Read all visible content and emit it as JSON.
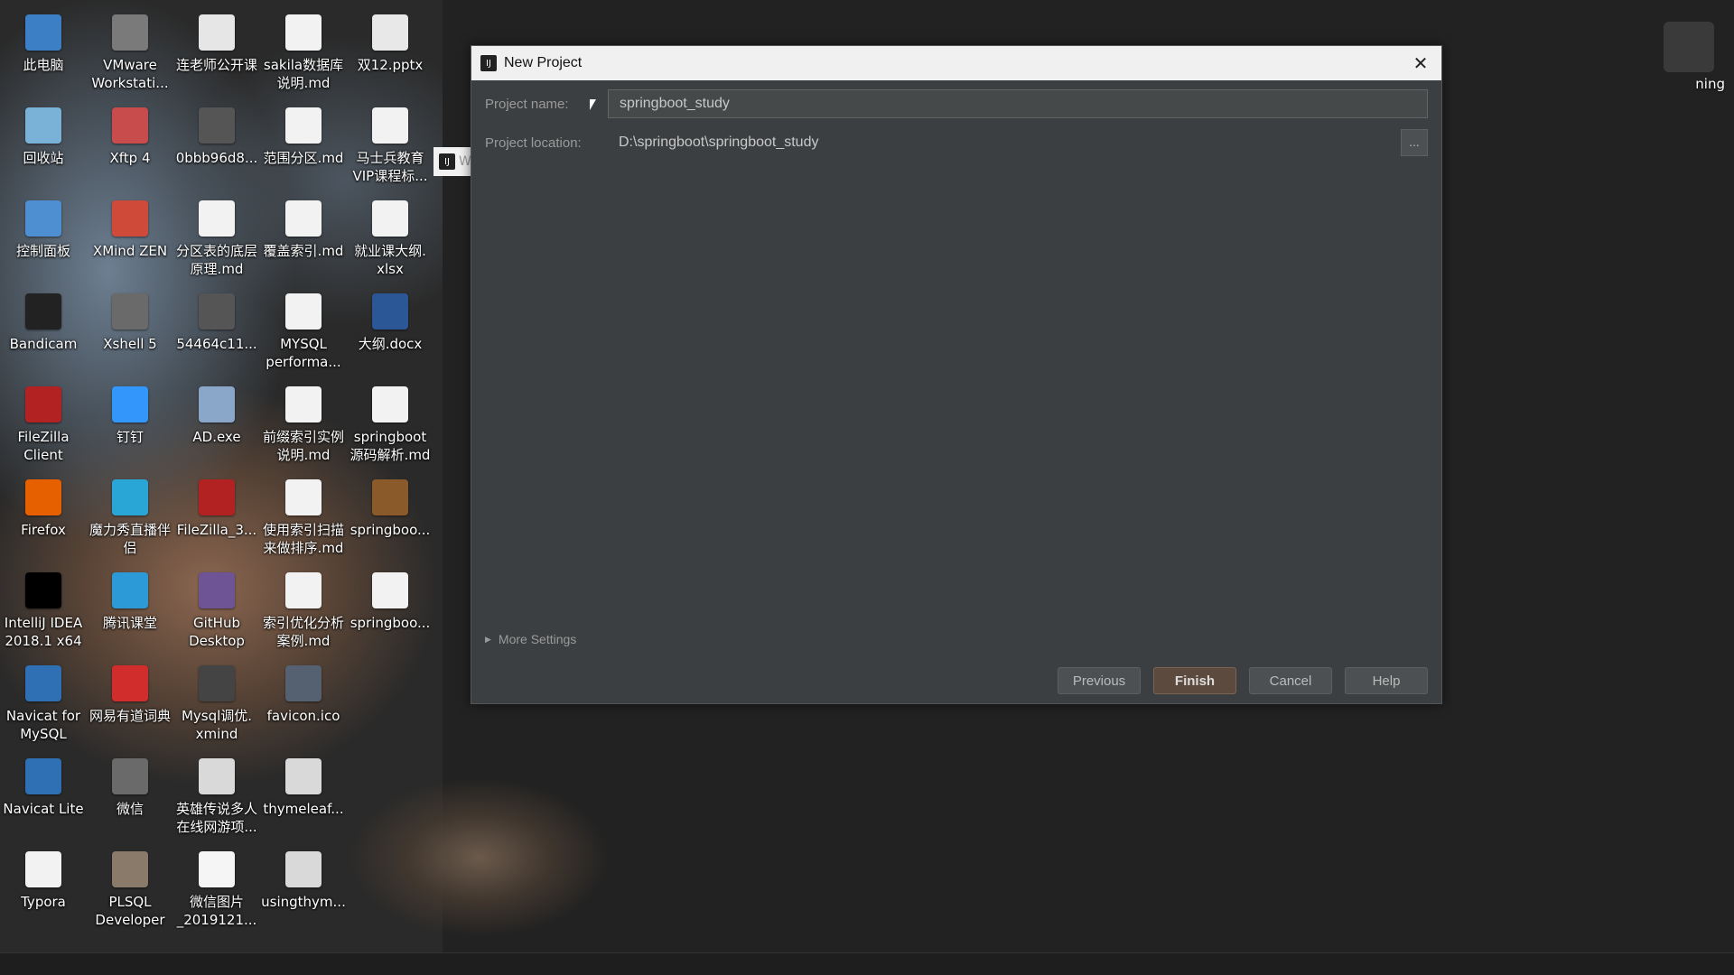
{
  "desktop": {
    "icons": [
      {
        "label": "此电脑",
        "icon": "computer-icon",
        "color": "#3c7fc4"
      },
      {
        "label": "VMware\nWorkstati...",
        "icon": "vmware-icon",
        "color": "#7a7a7a"
      },
      {
        "label": "连老师公开课",
        "icon": "file-icon",
        "color": "#e6e6e6"
      },
      {
        "label": "sakila数据库\n说明.md",
        "icon": "markdown-icon",
        "color": "#f2f2f2"
      },
      {
        "label": "双12.pptx",
        "icon": "pptx-icon",
        "color": "#e8e8e8"
      },
      {
        "label": "回收站",
        "icon": "recycle-bin-icon",
        "color": "#7ab1d6"
      },
      {
        "label": "Xftp 4",
        "icon": "xftp-icon",
        "color": "#c94c4c"
      },
      {
        "label": "0bbb96d8...",
        "icon": "image-icon",
        "color": "#555555"
      },
      {
        "label": "范围分区.md",
        "icon": "markdown-icon",
        "color": "#f2f2f2"
      },
      {
        "label": "马士兵教育\nVIP课程标...",
        "icon": "excel-icon",
        "color": "#f2f2f2"
      },
      {
        "label": "控制面板",
        "icon": "control-panel-icon",
        "color": "#4d8fd0"
      },
      {
        "label": "XMind ZEN",
        "icon": "xmind-icon",
        "color": "#d04a3a"
      },
      {
        "label": "分区表的底层\n原理.md",
        "icon": "markdown-icon",
        "color": "#f2f2f2"
      },
      {
        "label": "覆盖索引.md",
        "icon": "markdown-icon",
        "color": "#f2f2f2"
      },
      {
        "label": "就业课大纲.\nxlsx",
        "icon": "excel-icon",
        "color": "#f2f2f2"
      },
      {
        "label": "Bandicam",
        "icon": "bandicam-icon",
        "color": "#222222"
      },
      {
        "label": "Xshell 5",
        "icon": "xshell-icon",
        "color": "#6a6a6a"
      },
      {
        "label": "54464c11...",
        "icon": "image-icon",
        "color": "#555555"
      },
      {
        "label": "MYSQL\nperforma...",
        "icon": "markdown-icon",
        "color": "#f2f2f2"
      },
      {
        "label": "大纲.docx",
        "icon": "word-icon",
        "color": "#2b5797"
      },
      {
        "label": "FileZilla\nClient",
        "icon": "filezilla-icon",
        "color": "#b22222"
      },
      {
        "label": "钉钉",
        "icon": "dingtalk-icon",
        "color": "#3296fa"
      },
      {
        "label": "AD.exe",
        "icon": "exe-icon",
        "color": "#8aa6c8"
      },
      {
        "label": "前缀索引实例\n说明.md",
        "icon": "markdown-icon",
        "color": "#f2f2f2"
      },
      {
        "label": "springboot\n源码解析.md",
        "icon": "markdown-icon",
        "color": "#f2f2f2"
      },
      {
        "label": "Firefox",
        "icon": "firefox-icon",
        "color": "#e66000"
      },
      {
        "label": "魔力秀直播伴\n侣",
        "icon": "live-stream-icon",
        "color": "#2aa6d6"
      },
      {
        "label": "FileZilla_3...",
        "icon": "filezilla-icon",
        "color": "#b22222"
      },
      {
        "label": "使用索引扫描\n来做排序.md",
        "icon": "markdown-icon",
        "color": "#f2f2f2"
      },
      {
        "label": "springboo...",
        "icon": "archive-icon",
        "color": "#8b5a2b"
      },
      {
        "label": "IntelliJ IDEA\n2018.1 x64",
        "icon": "intellij-icon",
        "color": "#000000"
      },
      {
        "label": "腾讯课堂",
        "icon": "tencent-classroom-icon",
        "color": "#2c9ad6"
      },
      {
        "label": "GitHub\nDesktop",
        "icon": "github-icon",
        "color": "#6e5494"
      },
      {
        "label": "索引优化分析\n案例.md",
        "icon": "markdown-icon",
        "color": "#f2f2f2"
      },
      {
        "label": "springboo...",
        "icon": "file-icon",
        "color": "#f2f2f2"
      },
      {
        "label": "Navicat for\nMySQL",
        "icon": "navicat-icon",
        "color": "#2f6fb3"
      },
      {
        "label": "网易有道词典",
        "icon": "youdao-icon",
        "color": "#d22d2d"
      },
      {
        "label": "Mysql调优.\nxmind",
        "icon": "xmind-file-icon",
        "color": "#444444"
      },
      {
        "label": "favicon.ico",
        "icon": "favicon-icon",
        "color": "#556070"
      },
      {
        "label": "Navicat Lite",
        "icon": "navicat-icon",
        "color": "#2f6fb3"
      },
      {
        "label": "微信",
        "icon": "wechat-icon",
        "color": "#6a6a6a"
      },
      {
        "label": "英雄传说多人\n在线网游项...",
        "icon": "pdf-icon",
        "color": "#d9d9d9"
      },
      {
        "label": "thymeleaf...",
        "icon": "pdf-icon",
        "color": "#d9d9d9"
      },
      {
        "label": "Typora",
        "icon": "typora-icon",
        "color": "#f2f2f2"
      },
      {
        "label": "PLSQL\nDeveloper",
        "icon": "plsql-icon",
        "color": "#8a7a6a"
      },
      {
        "label": "微信图片\n_2019121...",
        "icon": "image-icon",
        "color": "#f5f5f5"
      },
      {
        "label": "usingthym...",
        "icon": "pdf-icon",
        "color": "#d9d9d9"
      }
    ],
    "corner_icon_label": "ning",
    "side_tab_peek": "W"
  },
  "dialog": {
    "title": "New Project",
    "close_symbol": "✕",
    "app_icon": "IJ",
    "fields": {
      "project_name_label": "Project name:",
      "project_name_value": "springboot_study",
      "project_location_label": "Project location:",
      "project_location_value": "D:\\springboot\\springboot_study",
      "browse_label": "..."
    },
    "more_settings_label": "More Settings",
    "buttons": {
      "previous": "Previous",
      "finish": "Finish",
      "cancel": "Cancel",
      "help": "Help"
    }
  },
  "colors": {
    "dialog_bg": "#3c3f41",
    "titlebar_bg": "#f0f0f0",
    "primary_button": "#5c4a3e",
    "desktop_bg": "#222222"
  }
}
